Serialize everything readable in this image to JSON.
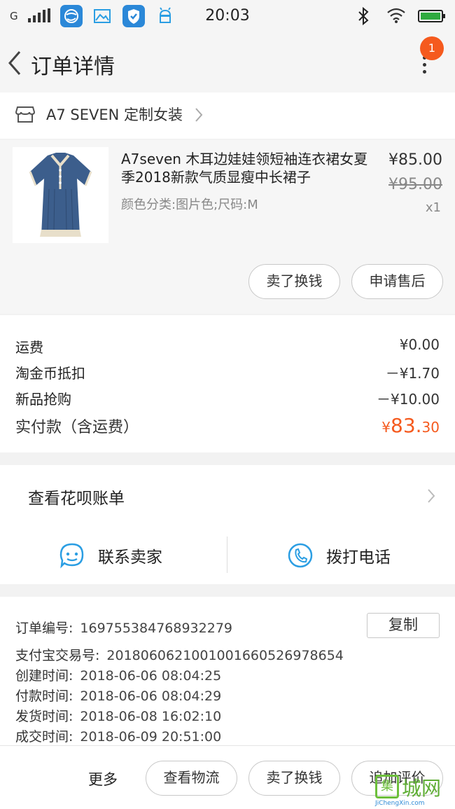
{
  "status_bar": {
    "signal_label": "G",
    "time": "20:03",
    "icons": [
      "signal-bars-icon",
      "browser-icon",
      "gallery-icon",
      "shield-icon",
      "android-icon",
      "bluetooth-icon",
      "wifi-icon",
      "battery-icon"
    ]
  },
  "navbar": {
    "title": "订单详情",
    "badge_count": "1",
    "icons": [
      "back-arrow-icon",
      "more-dots-icon"
    ]
  },
  "store": {
    "name": "A7 SEVEN 定制女装"
  },
  "product": {
    "title": "A7seven 木耳边娃娃领短袖连衣裙女夏季2018新款气质显瘦中长裙子",
    "spec": "颜色分类:图片色;尺码:M",
    "price": "¥85.00",
    "original_price": "¥95.00",
    "quantity": "x1",
    "actions": [
      "卖了换钱",
      "申请售后"
    ]
  },
  "costs": {
    "rows": [
      {
        "label": "运费",
        "value": "¥0.00"
      },
      {
        "label": "淘金币抵扣",
        "value": "－¥1.70"
      },
      {
        "label": "新品抢购",
        "value": "－¥10.00"
      }
    ],
    "total_label": "实付款（含运费）",
    "total_currency": "¥",
    "total_int": "83.",
    "total_dec": "30",
    "accent_color": "#f55a1e"
  },
  "huabei": {
    "label": "查看花呗账单"
  },
  "contact": {
    "seller": "联系卖家",
    "phone": "拨打电话",
    "icon_color": "#2b9ee3"
  },
  "order_info": {
    "rows": [
      {
        "label": "订单编号:",
        "value": "169755384768932279"
      },
      {
        "label": "支付宝交易号:",
        "value": "2018060621001001660526978654"
      },
      {
        "label": "创建时间:",
        "value": "2018-06-06 08:04:25"
      },
      {
        "label": "付款时间:",
        "value": "2018-06-06 08:04:29"
      },
      {
        "label": "发货时间:",
        "value": "2018-06-08 16:02:10"
      },
      {
        "label": "成交时间:",
        "value": "2018-06-09 20:51:00"
      }
    ],
    "copy_label": "复制"
  },
  "bottom_bar": {
    "more": "更多",
    "buttons": [
      "查看物流",
      "卖了换钱",
      "追加评价"
    ]
  },
  "watermark": {
    "box_char": "集",
    "text": "城网",
    "url": "JiChengXin.com"
  }
}
